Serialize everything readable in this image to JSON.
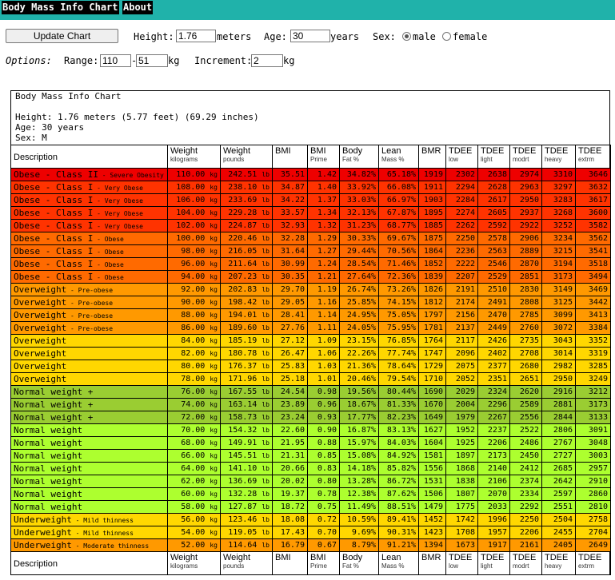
{
  "nav": {
    "title": "Body Mass Info Chart",
    "about": "About"
  },
  "form": {
    "update_button": "Update Chart",
    "height_label": "Height:",
    "height_value": "1.76",
    "height_unit": "meters",
    "age_label": "Age:",
    "age_value": "30",
    "age_unit": "years",
    "sex_label": "Sex:",
    "male_label": "male",
    "female_label": "female",
    "sex_selected": "male",
    "options_label": "Options:",
    "range_label": "Range:",
    "range_from": "110",
    "range_sep": "-",
    "range_to": "51",
    "range_unit": "kg",
    "increment_label": "Increment:",
    "increment_value": "2",
    "increment_unit": "kg"
  },
  "chart_info": {
    "title": "Body Mass Info Chart",
    "height_line": "Height: 1.76 meters (5.77 feet) (69.29 inches)",
    "age_line": "Age: 30 years",
    "sex_line": "Sex: M"
  },
  "columns": [
    {
      "label": "Description",
      "sub": ""
    },
    {
      "label": "Weight",
      "sub": "kilograms"
    },
    {
      "label": "Weight",
      "sub": "pounds"
    },
    {
      "label": "BMI",
      "sub": ""
    },
    {
      "label": "BMI",
      "sub": "Prime"
    },
    {
      "label": "Body",
      "sub": "Fat %"
    },
    {
      "label": "Lean",
      "sub": "Mass %"
    },
    {
      "label": "BMR",
      "sub": ""
    },
    {
      "label": "TDEE",
      "sub": "low"
    },
    {
      "label": "TDEE",
      "sub": "light"
    },
    {
      "label": "TDEE",
      "sub": "modrt"
    },
    {
      "label": "TDEE",
      "sub": "heavy"
    },
    {
      "label": "TDEE",
      "sub": "extrm"
    }
  ],
  "colors": {
    "obese2": "#ee0000",
    "obese1a": "#ff3300",
    "obese1b": "#ff6a00",
    "overweight_pre": "#ff9900",
    "overweight": "#ffd700",
    "normal_plus": "#9acd32",
    "normal": "#adff2f",
    "underweight_mild": "#ffd700",
    "underweight_mod": "#ff9900"
  },
  "rows": [
    {
      "desc": "Obese - Class II",
      "cls": " - Severe Obesity",
      "kg": "110.00",
      "lb": "242.51",
      "bmi": "35.51",
      "prime": "1.42",
      "fat": "34.82%",
      "lean": "65.18%",
      "bmr": "1919",
      "t1": "2302",
      "t2": "2638",
      "t3": "2974",
      "t4": "3310",
      "t5": "3646",
      "color": "obese2"
    },
    {
      "desc": "Obese - Class I",
      "cls": " - Very Obese",
      "kg": "108.00",
      "lb": "238.10",
      "bmi": "34.87",
      "prime": "1.40",
      "fat": "33.92%",
      "lean": "66.08%",
      "bmr": "1911",
      "t1": "2294",
      "t2": "2628",
      "t3": "2963",
      "t4": "3297",
      "t5": "3632",
      "color": "obese1a"
    },
    {
      "desc": "Obese - Class I",
      "cls": " - Very Obese",
      "kg": "106.00",
      "lb": "233.69",
      "bmi": "34.22",
      "prime": "1.37",
      "fat": "33.03%",
      "lean": "66.97%",
      "bmr": "1903",
      "t1": "2284",
      "t2": "2617",
      "t3": "2950",
      "t4": "3283",
      "t5": "3617",
      "color": "obese1a"
    },
    {
      "desc": "Obese - Class I",
      "cls": " - Very Obese",
      "kg": "104.00",
      "lb": "229.28",
      "bmi": "33.57",
      "prime": "1.34",
      "fat": "32.13%",
      "lean": "67.87%",
      "bmr": "1895",
      "t1": "2274",
      "t2": "2605",
      "t3": "2937",
      "t4": "3268",
      "t5": "3600",
      "color": "obese1a"
    },
    {
      "desc": "Obese - Class I",
      "cls": " - Very Obese",
      "kg": "102.00",
      "lb": "224.87",
      "bmi": "32.93",
      "prime": "1.32",
      "fat": "31.23%",
      "lean": "68.77%",
      "bmr": "1885",
      "t1": "2262",
      "t2": "2592",
      "t3": "2922",
      "t4": "3252",
      "t5": "3582",
      "color": "obese1a"
    },
    {
      "desc": "Obese - Class I",
      "cls": " - Obese",
      "kg": "100.00",
      "lb": "220.46",
      "bmi": "32.28",
      "prime": "1.29",
      "fat": "30.33%",
      "lean": "69.67%",
      "bmr": "1875",
      "t1": "2250",
      "t2": "2578",
      "t3": "2906",
      "t4": "3234",
      "t5": "3562",
      "color": "obese1b"
    },
    {
      "desc": "Obese - Class I",
      "cls": " - Obese",
      "kg": "98.00",
      "lb": "216.05",
      "bmi": "31.64",
      "prime": "1.27",
      "fat": "29.44%",
      "lean": "70.56%",
      "bmr": "1864",
      "t1": "2236",
      "t2": "2563",
      "t3": "2889",
      "t4": "3215",
      "t5": "3541",
      "color": "obese1b"
    },
    {
      "desc": "Obese - Class I",
      "cls": " - Obese",
      "kg": "96.00",
      "lb": "211.64",
      "bmi": "30.99",
      "prime": "1.24",
      "fat": "28.54%",
      "lean": "71.46%",
      "bmr": "1852",
      "t1": "2222",
      "t2": "2546",
      "t3": "2870",
      "t4": "3194",
      "t5": "3518",
      "color": "obese1b"
    },
    {
      "desc": "Obese - Class I",
      "cls": " - Obese",
      "kg": "94.00",
      "lb": "207.23",
      "bmi": "30.35",
      "prime": "1.21",
      "fat": "27.64%",
      "lean": "72.36%",
      "bmr": "1839",
      "t1": "2207",
      "t2": "2529",
      "t3": "2851",
      "t4": "3173",
      "t5": "3494",
      "color": "obese1b"
    },
    {
      "desc": "Overweight",
      "cls": " - Pre-obese",
      "kg": "92.00",
      "lb": "202.83",
      "bmi": "29.70",
      "prime": "1.19",
      "fat": "26.74%",
      "lean": "73.26%",
      "bmr": "1826",
      "t1": "2191",
      "t2": "2510",
      "t3": "2830",
      "t4": "3149",
      "t5": "3469",
      "color": "overweight_pre"
    },
    {
      "desc": "Overweight",
      "cls": " - Pre-obese",
      "kg": "90.00",
      "lb": "198.42",
      "bmi": "29.05",
      "prime": "1.16",
      "fat": "25.85%",
      "lean": "74.15%",
      "bmr": "1812",
      "t1": "2174",
      "t2": "2491",
      "t3": "2808",
      "t4": "3125",
      "t5": "3442",
      "color": "overweight_pre"
    },
    {
      "desc": "Overweight",
      "cls": " - Pre-obese",
      "kg": "88.00",
      "lb": "194.01",
      "bmi": "28.41",
      "prime": "1.14",
      "fat": "24.95%",
      "lean": "75.05%",
      "bmr": "1797",
      "t1": "2156",
      "t2": "2470",
      "t3": "2785",
      "t4": "3099",
      "t5": "3413",
      "color": "overweight_pre"
    },
    {
      "desc": "Overweight",
      "cls": " - Pre-obese",
      "kg": "86.00",
      "lb": "189.60",
      "bmi": "27.76",
      "prime": "1.11",
      "fat": "24.05%",
      "lean": "75.95%",
      "bmr": "1781",
      "t1": "2137",
      "t2": "2449",
      "t3": "2760",
      "t4": "3072",
      "t5": "3384",
      "color": "overweight_pre"
    },
    {
      "desc": "Overweight",
      "cls": "",
      "kg": "84.00",
      "lb": "185.19",
      "bmi": "27.12",
      "prime": "1.09",
      "fat": "23.15%",
      "lean": "76.85%",
      "bmr": "1764",
      "t1": "2117",
      "t2": "2426",
      "t3": "2735",
      "t4": "3043",
      "t5": "3352",
      "color": "overweight"
    },
    {
      "desc": "Overweight",
      "cls": "",
      "kg": "82.00",
      "lb": "180.78",
      "bmi": "26.47",
      "prime": "1.06",
      "fat": "22.26%",
      "lean": "77.74%",
      "bmr": "1747",
      "t1": "2096",
      "t2": "2402",
      "t3": "2708",
      "t4": "3014",
      "t5": "3319",
      "color": "overweight"
    },
    {
      "desc": "Overweight",
      "cls": "",
      "kg": "80.00",
      "lb": "176.37",
      "bmi": "25.83",
      "prime": "1.03",
      "fat": "21.36%",
      "lean": "78.64%",
      "bmr": "1729",
      "t1": "2075",
      "t2": "2377",
      "t3": "2680",
      "t4": "2982",
      "t5": "3285",
      "color": "overweight"
    },
    {
      "desc": "Overweight",
      "cls": "",
      "kg": "78.00",
      "lb": "171.96",
      "bmi": "25.18",
      "prime": "1.01",
      "fat": "20.46%",
      "lean": "79.54%",
      "bmr": "1710",
      "t1": "2052",
      "t2": "2351",
      "t3": "2651",
      "t4": "2950",
      "t5": "3249",
      "color": "overweight"
    },
    {
      "desc": "Normal weight +",
      "cls": "",
      "kg": "76.00",
      "lb": "167.55",
      "bmi": "24.54",
      "prime": "0.98",
      "fat": "19.56%",
      "lean": "80.44%",
      "bmr": "1690",
      "t1": "2029",
      "t2": "2324",
      "t3": "2620",
      "t4": "2916",
      "t5": "3212",
      "color": "normal_plus"
    },
    {
      "desc": "Normal weight +",
      "cls": "",
      "kg": "74.00",
      "lb": "163.14",
      "bmi": "23.89",
      "prime": "0.96",
      "fat": "18.67%",
      "lean": "81.33%",
      "bmr": "1670",
      "t1": "2004",
      "t2": "2296",
      "t3": "2589",
      "t4": "2881",
      "t5": "3173",
      "color": "normal_plus"
    },
    {
      "desc": "Normal weight +",
      "cls": "",
      "kg": "72.00",
      "lb": "158.73",
      "bmi": "23.24",
      "prime": "0.93",
      "fat": "17.77%",
      "lean": "82.23%",
      "bmr": "1649",
      "t1": "1979",
      "t2": "2267",
      "t3": "2556",
      "t4": "2844",
      "t5": "3133",
      "color": "normal_plus"
    },
    {
      "desc": "Normal weight",
      "cls": "",
      "kg": "70.00",
      "lb": "154.32",
      "bmi": "22.60",
      "prime": "0.90",
      "fat": "16.87%",
      "lean": "83.13%",
      "bmr": "1627",
      "t1": "1952",
      "t2": "2237",
      "t3": "2522",
      "t4": "2806",
      "t5": "3091",
      "color": "normal"
    },
    {
      "desc": "Normal weight",
      "cls": "",
      "kg": "68.00",
      "lb": "149.91",
      "bmi": "21.95",
      "prime": "0.88",
      "fat": "15.97%",
      "lean": "84.03%",
      "bmr": "1604",
      "t1": "1925",
      "t2": "2206",
      "t3": "2486",
      "t4": "2767",
      "t5": "3048",
      "color": "normal"
    },
    {
      "desc": "Normal weight",
      "cls": "",
      "kg": "66.00",
      "lb": "145.51",
      "bmi": "21.31",
      "prime": "0.85",
      "fat": "15.08%",
      "lean": "84.92%",
      "bmr": "1581",
      "t1": "1897",
      "t2": "2173",
      "t3": "2450",
      "t4": "2727",
      "t5": "3003",
      "color": "normal"
    },
    {
      "desc": "Normal weight",
      "cls": "",
      "kg": "64.00",
      "lb": "141.10",
      "bmi": "20.66",
      "prime": "0.83",
      "fat": "14.18%",
      "lean": "85.82%",
      "bmr": "1556",
      "t1": "1868",
      "t2": "2140",
      "t3": "2412",
      "t4": "2685",
      "t5": "2957",
      "color": "normal"
    },
    {
      "desc": "Normal weight",
      "cls": "",
      "kg": "62.00",
      "lb": "136.69",
      "bmi": "20.02",
      "prime": "0.80",
      "fat": "13.28%",
      "lean": "86.72%",
      "bmr": "1531",
      "t1": "1838",
      "t2": "2106",
      "t3": "2374",
      "t4": "2642",
      "t5": "2910",
      "color": "normal"
    },
    {
      "desc": "Normal weight",
      "cls": "",
      "kg": "60.00",
      "lb": "132.28",
      "bmi": "19.37",
      "prime": "0.78",
      "fat": "12.38%",
      "lean": "87.62%",
      "bmr": "1506",
      "t1": "1807",
      "t2": "2070",
      "t3": "2334",
      "t4": "2597",
      "t5": "2860",
      "color": "normal"
    },
    {
      "desc": "Normal weight",
      "cls": "",
      "kg": "58.00",
      "lb": "127.87",
      "bmi": "18.72",
      "prime": "0.75",
      "fat": "11.49%",
      "lean": "88.51%",
      "bmr": "1479",
      "t1": "1775",
      "t2": "2033",
      "t3": "2292",
      "t4": "2551",
      "t5": "2810",
      "color": "normal"
    },
    {
      "desc": "Underweight",
      "cls": " - Mild thinness",
      "kg": "56.00",
      "lb": "123.46",
      "bmi": "18.08",
      "prime": "0.72",
      "fat": "10.59%",
      "lean": "89.41%",
      "bmr": "1452",
      "t1": "1742",
      "t2": "1996",
      "t3": "2250",
      "t4": "2504",
      "t5": "2758",
      "color": "underweight_mild"
    },
    {
      "desc": "Underweight",
      "cls": " - Mild thinness",
      "kg": "54.00",
      "lb": "119.05",
      "bmi": "17.43",
      "prime": "0.70",
      "fat": "9.69%",
      "lean": "90.31%",
      "bmr": "1423",
      "t1": "1708",
      "t2": "1957",
      "t3": "2206",
      "t4": "2455",
      "t5": "2704",
      "color": "underweight_mild"
    },
    {
      "desc": "Underweight",
      "cls": " - Moderate thinness",
      "kg": "52.00",
      "lb": "114.64",
      "bmi": "16.79",
      "prime": "0.67",
      "fat": "8.79%",
      "lean": "91.21%",
      "bmr": "1394",
      "t1": "1673",
      "t2": "1917",
      "t3": "2161",
      "t4": "2405",
      "t5": "2649",
      "color": "underweight_mod"
    }
  ],
  "units": {
    "kg": "kg",
    "lb": "lb"
  }
}
